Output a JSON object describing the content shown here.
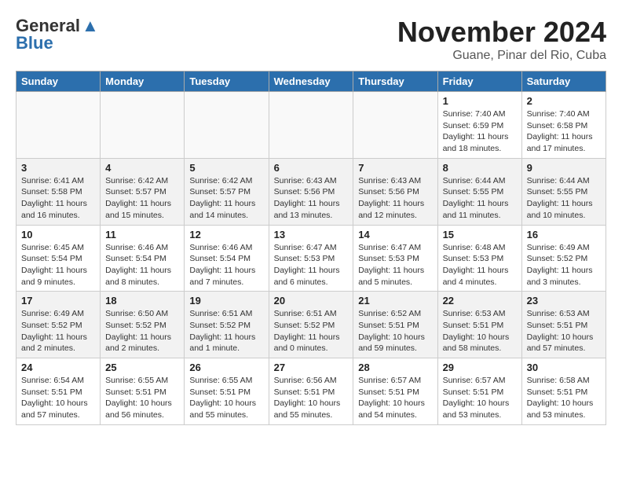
{
  "logo": {
    "line1": "General",
    "line2": "Blue",
    "bird_symbol": "▲"
  },
  "header": {
    "month_title": "November 2024",
    "subtitle": "Guane, Pinar del Rio, Cuba"
  },
  "weekdays": [
    "Sunday",
    "Monday",
    "Tuesday",
    "Wednesday",
    "Thursday",
    "Friday",
    "Saturday"
  ],
  "weeks": [
    [
      {
        "day": "",
        "info": ""
      },
      {
        "day": "",
        "info": ""
      },
      {
        "day": "",
        "info": ""
      },
      {
        "day": "",
        "info": ""
      },
      {
        "day": "",
        "info": ""
      },
      {
        "day": "1",
        "info": "Sunrise: 7:40 AM\nSunset: 6:59 PM\nDaylight: 11 hours and 18 minutes."
      },
      {
        "day": "2",
        "info": "Sunrise: 7:40 AM\nSunset: 6:58 PM\nDaylight: 11 hours and 17 minutes."
      }
    ],
    [
      {
        "day": "3",
        "info": "Sunrise: 6:41 AM\nSunset: 5:58 PM\nDaylight: 11 hours and 16 minutes."
      },
      {
        "day": "4",
        "info": "Sunrise: 6:42 AM\nSunset: 5:57 PM\nDaylight: 11 hours and 15 minutes."
      },
      {
        "day": "5",
        "info": "Sunrise: 6:42 AM\nSunset: 5:57 PM\nDaylight: 11 hours and 14 minutes."
      },
      {
        "day": "6",
        "info": "Sunrise: 6:43 AM\nSunset: 5:56 PM\nDaylight: 11 hours and 13 minutes."
      },
      {
        "day": "7",
        "info": "Sunrise: 6:43 AM\nSunset: 5:56 PM\nDaylight: 11 hours and 12 minutes."
      },
      {
        "day": "8",
        "info": "Sunrise: 6:44 AM\nSunset: 5:55 PM\nDaylight: 11 hours and 11 minutes."
      },
      {
        "day": "9",
        "info": "Sunrise: 6:44 AM\nSunset: 5:55 PM\nDaylight: 11 hours and 10 minutes."
      }
    ],
    [
      {
        "day": "10",
        "info": "Sunrise: 6:45 AM\nSunset: 5:54 PM\nDaylight: 11 hours and 9 minutes."
      },
      {
        "day": "11",
        "info": "Sunrise: 6:46 AM\nSunset: 5:54 PM\nDaylight: 11 hours and 8 minutes."
      },
      {
        "day": "12",
        "info": "Sunrise: 6:46 AM\nSunset: 5:54 PM\nDaylight: 11 hours and 7 minutes."
      },
      {
        "day": "13",
        "info": "Sunrise: 6:47 AM\nSunset: 5:53 PM\nDaylight: 11 hours and 6 minutes."
      },
      {
        "day": "14",
        "info": "Sunrise: 6:47 AM\nSunset: 5:53 PM\nDaylight: 11 hours and 5 minutes."
      },
      {
        "day": "15",
        "info": "Sunrise: 6:48 AM\nSunset: 5:53 PM\nDaylight: 11 hours and 4 minutes."
      },
      {
        "day": "16",
        "info": "Sunrise: 6:49 AM\nSunset: 5:52 PM\nDaylight: 11 hours and 3 minutes."
      }
    ],
    [
      {
        "day": "17",
        "info": "Sunrise: 6:49 AM\nSunset: 5:52 PM\nDaylight: 11 hours and 2 minutes."
      },
      {
        "day": "18",
        "info": "Sunrise: 6:50 AM\nSunset: 5:52 PM\nDaylight: 11 hours and 2 minutes."
      },
      {
        "day": "19",
        "info": "Sunrise: 6:51 AM\nSunset: 5:52 PM\nDaylight: 11 hours and 1 minute."
      },
      {
        "day": "20",
        "info": "Sunrise: 6:51 AM\nSunset: 5:52 PM\nDaylight: 11 hours and 0 minutes."
      },
      {
        "day": "21",
        "info": "Sunrise: 6:52 AM\nSunset: 5:51 PM\nDaylight: 10 hours and 59 minutes."
      },
      {
        "day": "22",
        "info": "Sunrise: 6:53 AM\nSunset: 5:51 PM\nDaylight: 10 hours and 58 minutes."
      },
      {
        "day": "23",
        "info": "Sunrise: 6:53 AM\nSunset: 5:51 PM\nDaylight: 10 hours and 57 minutes."
      }
    ],
    [
      {
        "day": "24",
        "info": "Sunrise: 6:54 AM\nSunset: 5:51 PM\nDaylight: 10 hours and 57 minutes."
      },
      {
        "day": "25",
        "info": "Sunrise: 6:55 AM\nSunset: 5:51 PM\nDaylight: 10 hours and 56 minutes."
      },
      {
        "day": "26",
        "info": "Sunrise: 6:55 AM\nSunset: 5:51 PM\nDaylight: 10 hours and 55 minutes."
      },
      {
        "day": "27",
        "info": "Sunrise: 6:56 AM\nSunset: 5:51 PM\nDaylight: 10 hours and 55 minutes."
      },
      {
        "day": "28",
        "info": "Sunrise: 6:57 AM\nSunset: 5:51 PM\nDaylight: 10 hours and 54 minutes."
      },
      {
        "day": "29",
        "info": "Sunrise: 6:57 AM\nSunset: 5:51 PM\nDaylight: 10 hours and 53 minutes."
      },
      {
        "day": "30",
        "info": "Sunrise: 6:58 AM\nSunset: 5:51 PM\nDaylight: 10 hours and 53 minutes."
      }
    ]
  ]
}
